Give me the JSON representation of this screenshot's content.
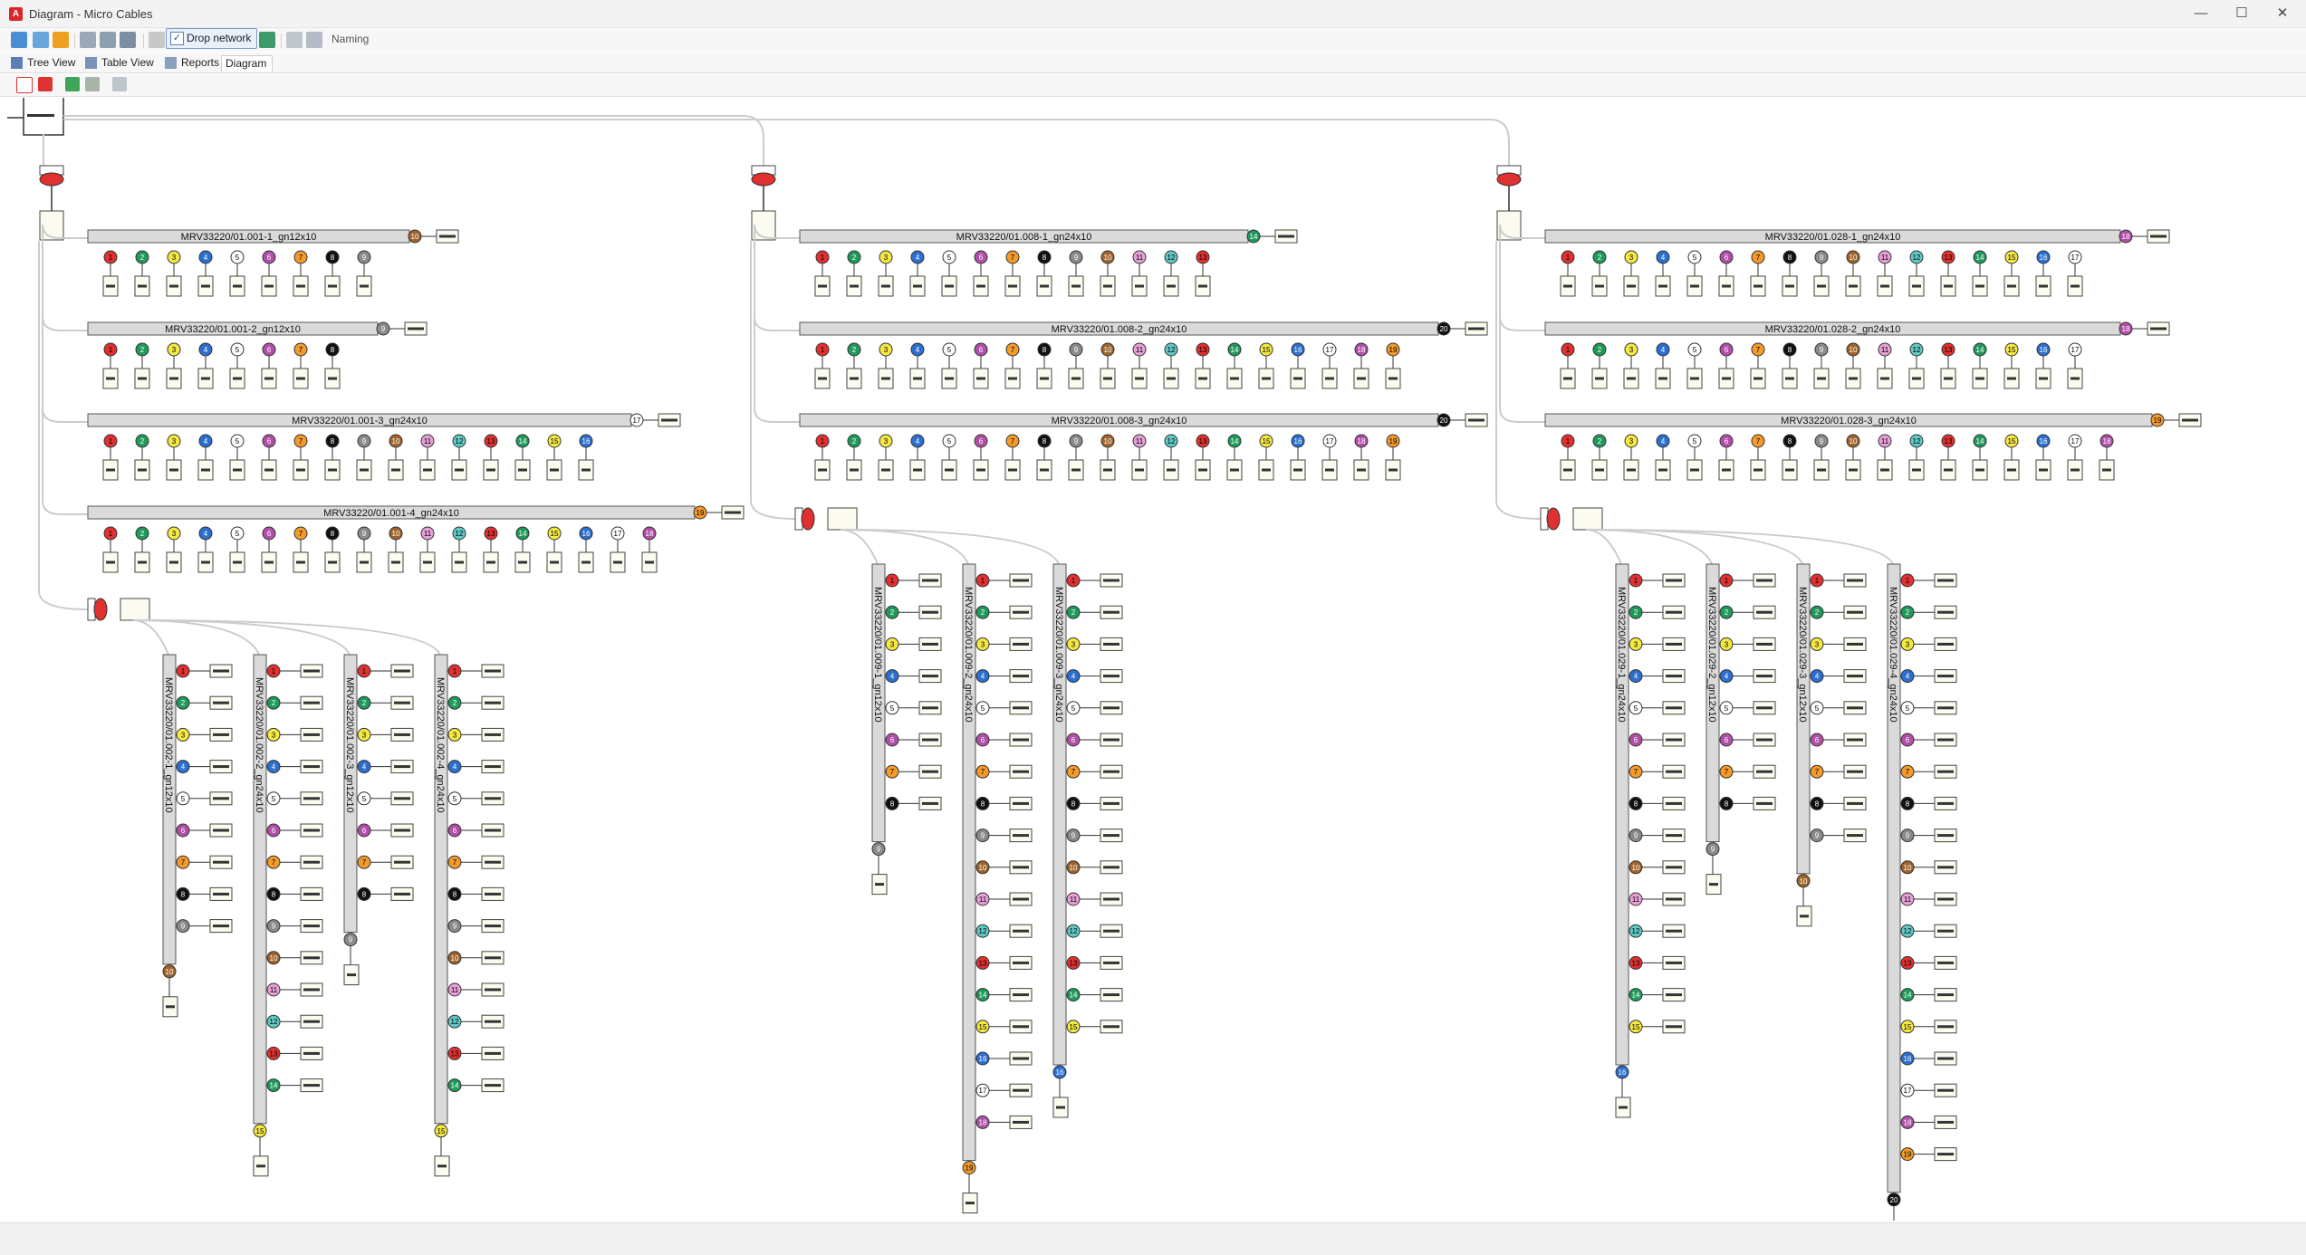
{
  "window": {
    "title": "Diagram - Micro Cables",
    "app_icon": "A",
    "controls": [
      "minimize-icon",
      "maximize-icon",
      "close-icon"
    ]
  },
  "toolbar": {
    "drop_network_label": "Drop network",
    "drop_network_checked": "✓",
    "naming_label": "Naming"
  },
  "tabs": [
    {
      "label": "Tree View",
      "icon": "tree-icon"
    },
    {
      "label": "Table View",
      "icon": "table-icon"
    },
    {
      "label": "Reports",
      "icon": "report-icon"
    },
    {
      "label": "Diagram",
      "icon": "diagram-icon",
      "active": true
    }
  ],
  "fiber_colors": [
    "#e03030",
    "#1f9a5a",
    "#f4e842",
    "#2b6fd0",
    "#ffffff",
    "#b14fa8",
    "#f39a2a",
    "#111111",
    "#8a8a8a",
    "#a0642a",
    "#e8a0d8",
    "#5fc9c6",
    "#e03030",
    "#1f9a5a",
    "#f4e842",
    "#2b6fd0",
    "#ffffff",
    "#b14fa8",
    "#f39a2a",
    "#111111",
    "#8a8a8a",
    "#a0642a",
    "#e8a0d8",
    "#5fc9c6"
  ],
  "groups": [
    {
      "horizontal_cables": [
        {
          "label": "MRV33220/01.001-1_gn12x10",
          "fibers": 9
        },
        {
          "label": "MRV33220/01.001-2_gn12x10",
          "fibers": 8
        },
        {
          "label": "MRV33220/01.001-3_gn24x10",
          "fibers": 16
        },
        {
          "label": "MRV33220/01.001-4_gn24x10",
          "fibers": 18
        }
      ],
      "vertical_cables": [
        {
          "label": "MRV33220/01.002-1_gn12x10",
          "fibers": 9,
          "end_fiber": "10"
        },
        {
          "label": "MRV33220/01.002-2_gn24x10",
          "fibers": 14,
          "end_fiber": "15"
        },
        {
          "label": "MRV33220/01.002-3_gn12x10",
          "fibers": 8,
          "end_fiber": "9"
        },
        {
          "label": "MRV33220/01.002-4_gn24x10",
          "fibers": 14,
          "end_fiber": "15"
        }
      ]
    },
    {
      "horizontal_cables": [
        {
          "label": "MRV33220/01.008-1_gn24x10",
          "fibers": 13
        },
        {
          "label": "MRV33220/01.008-2_gn24x10",
          "fibers": 19
        },
        {
          "label": "MRV33220/01.008-3_gn24x10",
          "fibers": 19
        }
      ],
      "vertical_cables": [
        {
          "label": "MRV33220/01.009-1_gn12x10",
          "fibers": 8,
          "end_fiber": "9"
        },
        {
          "label": "MRV33220/01.009-2_gn24x10",
          "fibers": 18,
          "end_fiber": "19"
        },
        {
          "label": "MRV33220/01.009-3_gn24x10",
          "fibers": 15,
          "end_fiber": "16"
        }
      ]
    },
    {
      "horizontal_cables": [
        {
          "label": "MRV33220/01.028-1_gn24x10",
          "fibers": 17
        },
        {
          "label": "MRV33220/01.028-2_gn24x10",
          "fibers": 17
        },
        {
          "label": "MRV33220/01.028-3_gn24x10",
          "fibers": 18
        }
      ],
      "vertical_cables": [
        {
          "label": "MRV33220/01.029-1_gn24x10",
          "fibers": 15,
          "end_fiber": "16"
        },
        {
          "label": "MRV33220/01.029-2_gn12x10",
          "fibers": 8,
          "end_fiber": "9"
        },
        {
          "label": "MRV33220/01.029-3_gn12x10",
          "fibers": 9,
          "end_fiber": "10"
        },
        {
          "label": "MRV33220/01.029-4_gn24x10",
          "fibers": 19,
          "end_fiber": "20"
        }
      ]
    }
  ]
}
